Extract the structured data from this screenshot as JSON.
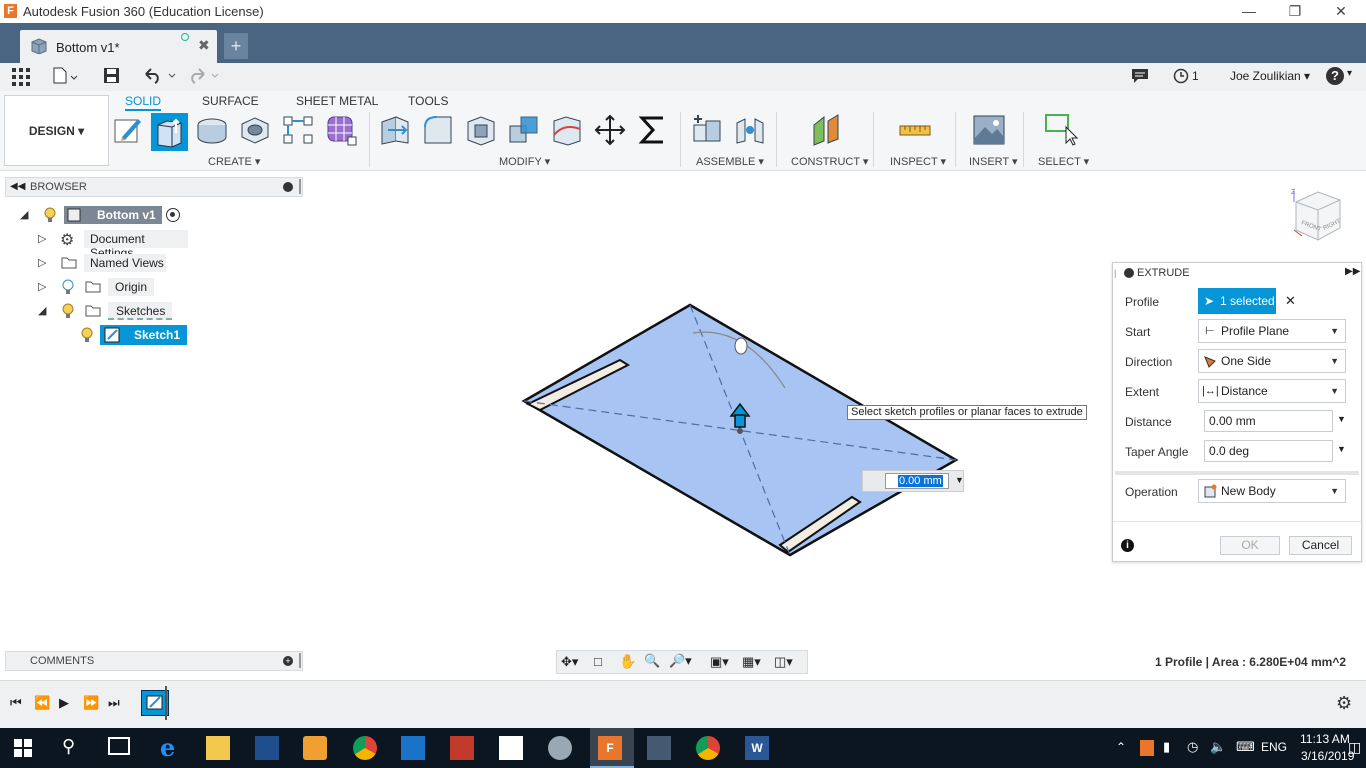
{
  "window": {
    "title": "Autodesk Fusion 360 (Education License)",
    "app_icon": "fusion-icon",
    "controls": [
      "minimize",
      "restore",
      "close"
    ]
  },
  "tabs": {
    "document_tab": "Bottom v1*",
    "new_tab_icon": "plus-icon"
  },
  "quickbar": {
    "jobs_count": "1",
    "user": "Joe Zoulikian"
  },
  "toolbar": {
    "workspace": "DESIGN",
    "tabs": [
      "SOLID",
      "SURFACE",
      "SHEET METAL",
      "TOOLS"
    ],
    "groups": {
      "create": "CREATE",
      "modify": "MODIFY",
      "assemble": "ASSEMBLE",
      "construct": "CONSTRUCT",
      "inspect": "INSPECT",
      "insert": "INSERT",
      "select": "SELECT"
    }
  },
  "browser": {
    "title": "BROWSER",
    "root": "Bottom v1",
    "items": [
      "Document Settings",
      "Named Views",
      "Origin",
      "Sketches"
    ],
    "sketch": "Sketch1"
  },
  "viewport": {
    "tooltip": "Select sketch profiles or planar faces to extrude",
    "distance_input": "0.00 mm",
    "status": "1 Profile | Area : 6.280E+04 mm^2",
    "colors": {
      "face": "#a7c4f2",
      "highlight": "#0696d7"
    }
  },
  "extrude": {
    "title": "EXTRUDE",
    "profile_label": "Profile",
    "profile_value": "1 selected",
    "start_label": "Start",
    "start_value": "Profile Plane",
    "direction_label": "Direction",
    "direction_value": "One Side",
    "extent_label": "Extent",
    "extent_value": "Distance",
    "distance_label": "Distance",
    "distance_value": "0.00 mm",
    "taper_label": "Taper Angle",
    "taper_value": "0.0 deg",
    "operation_label": "Operation",
    "operation_value": "New Body",
    "ok": "OK",
    "cancel": "Cancel"
  },
  "comments": {
    "title": "COMMENTS"
  },
  "taskbar": {
    "language": "ENG",
    "time": "11:13 AM",
    "date": "3/16/2019"
  }
}
